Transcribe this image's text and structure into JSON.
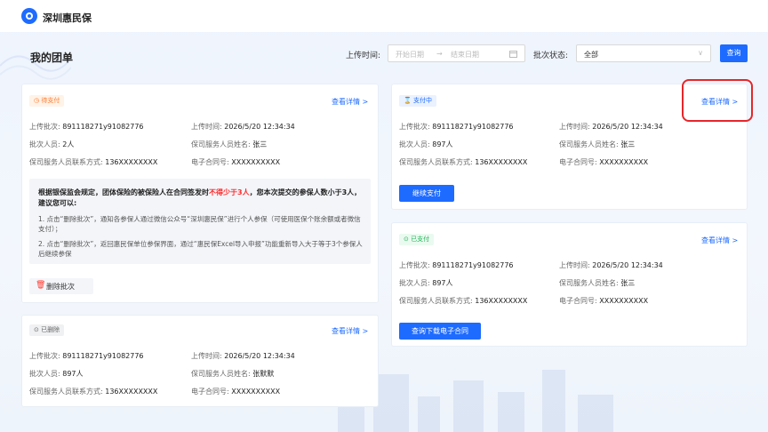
{
  "app": {
    "brand": "深圳惠民保"
  },
  "header": {
    "page_title": "我的团单",
    "upload_time_label": "上传时间:",
    "start_placeholder": "开始日期",
    "arrow": "→",
    "end_placeholder": "结束日期",
    "batch_status_label": "批次状态:",
    "batch_status_value": "全部",
    "query_button": "查询"
  },
  "cards": {
    "pending": {
      "tag": "待支付",
      "detail": "查看详情 >",
      "batch_label": "上传批次:",
      "batch_value": "891118271y91082776",
      "time_label": "上传时间:",
      "time_value": "2026/5/20 12:34:34",
      "people_label": "批次人员:",
      "people_value": "2人",
      "agent_label": "保司服务人员姓名:",
      "agent_value": "张三",
      "phone_label": "保司服务人员联系方式:",
      "phone_value": "136XXXXXXXX",
      "contract_label": "电子合同号:",
      "contract_value": "XXXXXXXXXX",
      "notice_title_a": "根据银保监会规定，团体保险的被保险人在合同签发时",
      "notice_title_red": "不得少于3人",
      "notice_title_b": "，您本次提交的参保人数小于3人，建议您可以:",
      "notice_p1": "1. 点击“删除批次”，通知各参保人通过微信公众号“深圳惠民保”进行个人参保（可使用医保个账余额或者微信支付）；",
      "notice_p2": "2. 点击“删除批次”，返回惠民保单位参保界面，通过“惠民保Excel导入申报”功能重新导入大于等于3个参保人后继续参保",
      "delete_button": "删除批次"
    },
    "deleted": {
      "tag": "已删除",
      "detail": "查看详情 >",
      "batch_label": "上传批次:",
      "batch_value": "891118271y91082776",
      "time_label": "上传时间:",
      "time_value": "2026/5/20 12:34:34",
      "people_label": "批次人员:",
      "people_value": "897人",
      "agent_label": "保司服务人员姓名:",
      "agent_value": "张默默",
      "phone_label": "保司服务人员联系方式:",
      "phone_value": "136XXXXXXXX",
      "contract_label": "电子合同号:",
      "contract_value": "XXXXXXXXXX"
    },
    "paying": {
      "tag": "支付中",
      "detail": "查看详情 >",
      "batch_label": "上传批次:",
      "batch_value": "891118271y91082776",
      "time_label": "上传时间:",
      "time_value": "2026/5/20 12:34:34",
      "people_label": "批次人员:",
      "people_value": "897人",
      "agent_label": "保司服务人员姓名:",
      "agent_value": "张三",
      "phone_label": "保司服务人员联系方式:",
      "phone_value": "136XXXXXXXX",
      "contract_label": "电子合同号:",
      "contract_value": "XXXXXXXXXX",
      "action_button": "继续支付"
    },
    "paid": {
      "tag": "已支付",
      "detail": "查看详情 >",
      "batch_label": "上传批次:",
      "batch_value": "891118271y91082776",
      "time_label": "上传时间:",
      "time_value": "2026/5/20 12:34:34",
      "people_label": "批次人员:",
      "people_value": "897人",
      "agent_label": "保司服务人员姓名:",
      "agent_value": "张三",
      "phone_label": "保司服务人员联系方式:",
      "phone_value": "136XXXXXXXX",
      "contract_label": "电子合同号:",
      "contract_value": "XXXXXXXXXX",
      "action_button": "查询下载电子合同"
    }
  },
  "colors": {
    "accent": "#1e6bff",
    "danger": "#ff2b2b",
    "highlight": "#e5262a"
  }
}
